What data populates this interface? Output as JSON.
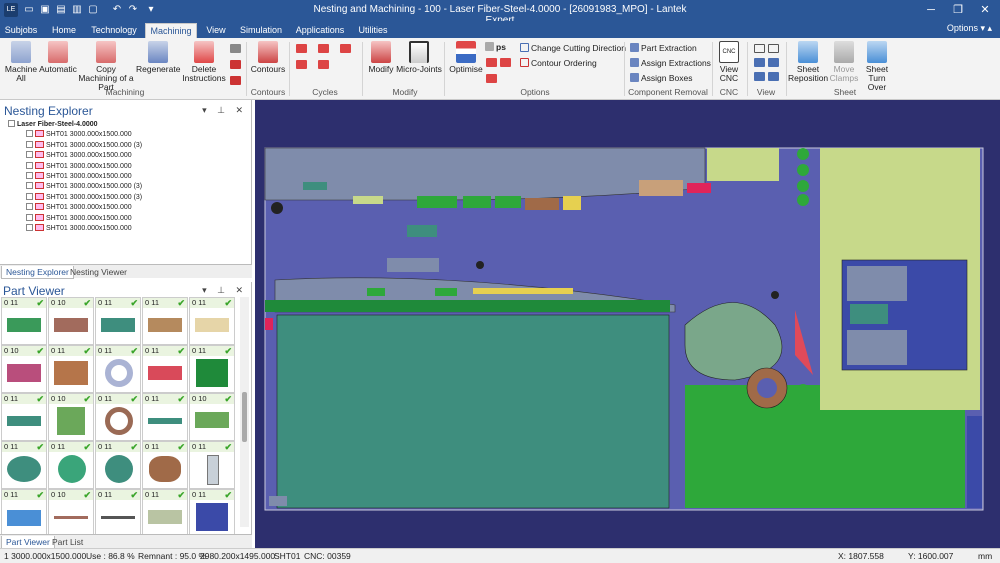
{
  "window": {
    "title": "Nesting and Machining - 100 - Laser Fiber-Steel-4.0000 - [26091983_MPO] - Lantek Expert",
    "options_label": "Options"
  },
  "tabs": [
    "Subjobs",
    "Home",
    "Technology",
    "Machining",
    "View",
    "Simulation",
    "Applications",
    "Utilities"
  ],
  "active_tab": "Machining",
  "ribbon": {
    "machine_all": "Machine All",
    "automatic": "Automatic",
    "copy_machining": "Copy Machining of a Part",
    "regenerate": "Regenerate",
    "delete_instructions": "Delete Instructions",
    "contours": "Contours",
    "modify": "Modify",
    "micro_joints": "Micro-Joints",
    "optimise": "Optimise",
    "ps": "ps",
    "change_cutting_direction": "Change Cutting Direction",
    "contour_ordering": "Contour Ordering",
    "part_extraction": "Part Extraction",
    "assign_extractions": "Assign Extractions",
    "assign_boxes": "Assign Boxes",
    "view_cnc": "View CNC",
    "sheet_reposition": "Sheet Reposition",
    "move_clamps": "Move Clamps",
    "sheet_turn_over": "Sheet Turn Over",
    "groups": {
      "machining": "Machining",
      "contours": "Contours",
      "cycles": "Cycles",
      "modify": "Modify",
      "options": "Options",
      "component_removal": "Component Removal",
      "cnc": "CNC",
      "view": "View",
      "sheet": "Sheet"
    }
  },
  "nesting_explorer": {
    "title": "Nesting Explorer",
    "root": "Laser Fiber-Steel-4.0000",
    "items": [
      "SHT01 3000.000x1500.000",
      "SHT01 3000.000x1500.000 (3)",
      "SHT01 3000.000x1500.000",
      "SHT01 3000.000x1500.000",
      "SHT01 3000.000x1500.000",
      "SHT01 3000.000x1500.000 (3)",
      "SHT01 3000.000x1500.000 (3)",
      "SHT01 3000.000x1500.000",
      "SHT01 3000.000x1500.000",
      "SHT01 3000.000x1500.000"
    ],
    "tabs": [
      "Nesting Explorer",
      "Nesting Viewer"
    ]
  },
  "part_viewer": {
    "title": "Part Viewer",
    "rows": [
      [
        "0 11",
        "0 10",
        "0 11",
        "0 11",
        "0 11"
      ],
      [
        "0 10",
        "0 11",
        "0 11",
        "0 11",
        "0 11"
      ],
      [
        "0 11",
        "0 10",
        "0 11",
        "0 11",
        "0 10"
      ],
      [
        "0 11",
        "0 11",
        "0 11",
        "0 11",
        "0 11"
      ],
      [
        "0 11",
        "0 10",
        "0 11",
        "0 11",
        "0 11"
      ]
    ],
    "tabs": [
      "Part Viewer",
      "Part List"
    ]
  },
  "status": {
    "sheet": "1  3000.000x1500.000",
    "use": "Use : 86.8 %",
    "remnant": "Remnant : 95.0 %",
    "dims": "2980.200x1495.000",
    "sheet_code": "SHT01",
    "cnc": "CNC: 00359",
    "x": "X: 1807.558",
    "y": "Y: 1600.007",
    "unit": "mm"
  },
  "colors": {
    "titlebar": "#2b5797",
    "canvas": "#2d2f6e",
    "sheet": "#5a5fb0",
    "part_green": "#2ea83a",
    "part_teal": "#3e8e7e",
    "part_lime": "#c7d98a",
    "part_grey": "#7f8cab"
  }
}
